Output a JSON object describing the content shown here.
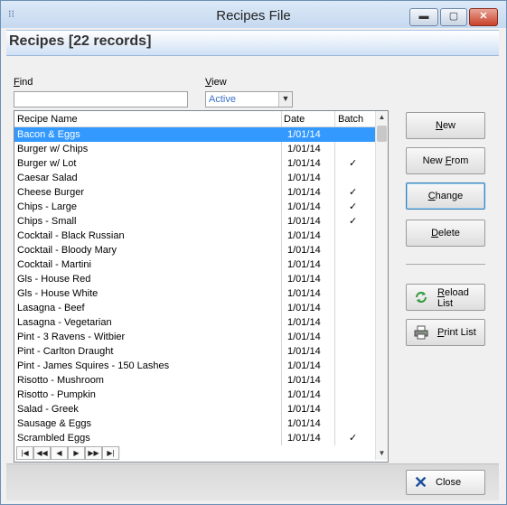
{
  "window": {
    "title": "Recipes File",
    "app_icon": "grid-icon"
  },
  "header": {
    "title": "Recipes [22 records]"
  },
  "find": {
    "label_prefix": "",
    "label_ul": "F",
    "label_rest": "ind",
    "value": ""
  },
  "view": {
    "label_ul": "V",
    "label_rest": "iew",
    "value": "Active"
  },
  "grid": {
    "columns": [
      "Recipe Name",
      "Date",
      "Batch"
    ],
    "rows": [
      {
        "name": "Bacon & Eggs",
        "date": "1/01/14",
        "batch": "",
        "selected": true
      },
      {
        "name": "Burger w/ Chips",
        "date": "1/01/14",
        "batch": ""
      },
      {
        "name": "Burger w/ Lot",
        "date": "1/01/14",
        "batch": "✓"
      },
      {
        "name": "Caesar Salad",
        "date": "1/01/14",
        "batch": ""
      },
      {
        "name": "Cheese Burger",
        "date": "1/01/14",
        "batch": "✓"
      },
      {
        "name": "Chips - Large",
        "date": "1/01/14",
        "batch": "✓"
      },
      {
        "name": "Chips - Small",
        "date": "1/01/14",
        "batch": "✓"
      },
      {
        "name": "Cocktail - Black Russian",
        "date": "1/01/14",
        "batch": ""
      },
      {
        "name": "Cocktail - Bloody Mary",
        "date": "1/01/14",
        "batch": ""
      },
      {
        "name": "Cocktail - Martini",
        "date": "1/01/14",
        "batch": ""
      },
      {
        "name": "Gls - House Red",
        "date": "1/01/14",
        "batch": ""
      },
      {
        "name": "Gls - House White",
        "date": "1/01/14",
        "batch": ""
      },
      {
        "name": "Lasagna - Beef",
        "date": "1/01/14",
        "batch": ""
      },
      {
        "name": "Lasagna - Vegetarian",
        "date": "1/01/14",
        "batch": ""
      },
      {
        "name": "Pint - 3 Ravens - Witbier",
        "date": "1/01/14",
        "batch": ""
      },
      {
        "name": "Pint - Carlton Draught",
        "date": "1/01/14",
        "batch": ""
      },
      {
        "name": "Pint - James Squires - 150 Lashes",
        "date": "1/01/14",
        "batch": ""
      },
      {
        "name": "Risotto - Mushroom",
        "date": "1/01/14",
        "batch": ""
      },
      {
        "name": "Risotto - Pumpkin",
        "date": "1/01/14",
        "batch": ""
      },
      {
        "name": "Salad - Greek",
        "date": "1/01/14",
        "batch": ""
      },
      {
        "name": "Sausage & Eggs",
        "date": "1/01/14",
        "batch": ""
      },
      {
        "name": "Scrambled Eggs",
        "date": "1/01/14",
        "batch": "✓"
      }
    ]
  },
  "buttons": {
    "new": {
      "ul": "N",
      "rest": "ew"
    },
    "new_from": {
      "pre": "New ",
      "ul": "F",
      "rest": "rom"
    },
    "change": {
      "ul": "C",
      "rest": "hange"
    },
    "delete": {
      "ul": "D",
      "rest": "elete"
    },
    "reload": {
      "line1_ul": "R",
      "line1_rest": "eload",
      "line2": "List"
    },
    "print": {
      "ul": "P",
      "rest": "rint List"
    },
    "close": {
      "label": "Close"
    }
  },
  "colors": {
    "selection": "#3399ff",
    "accent": "#1d4f9e"
  }
}
